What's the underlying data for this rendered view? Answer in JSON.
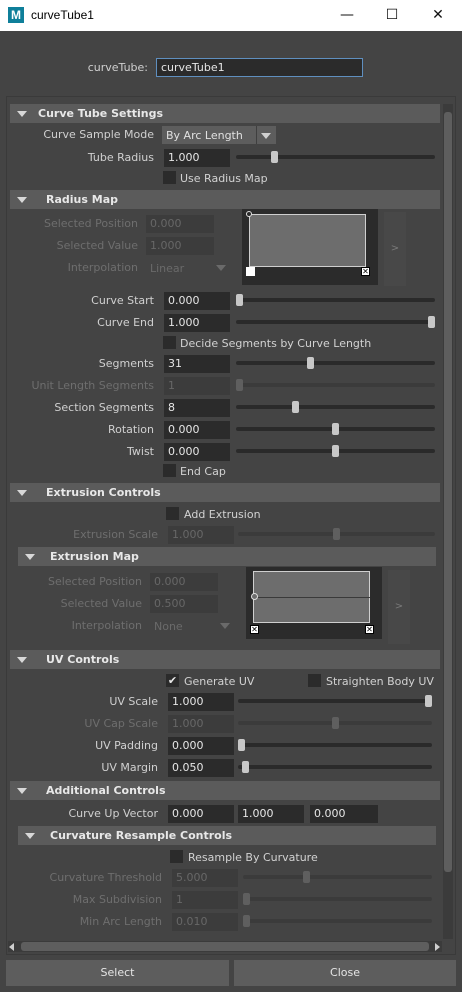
{
  "window": {
    "title": "curveTube1",
    "minimize": "—",
    "maximize": "☐",
    "close": "✕"
  },
  "node": {
    "label": "curveTube:",
    "value": "curveTube1"
  },
  "curve_tube_settings": {
    "header": "Curve Tube Settings",
    "sample_mode_label": "Curve Sample Mode",
    "sample_mode_value": "By Arc Length",
    "tube_radius_label": "Tube Radius",
    "tube_radius_value": "1.000",
    "tube_radius_slider": 0.18,
    "use_radius_map_label": "Use Radius Map"
  },
  "radius_map": {
    "header": "Radius Map",
    "selected_position_label": "Selected Position",
    "selected_position_value": "0.000",
    "selected_value_label": "Selected Value",
    "selected_value_value": "1.000",
    "interpolation_label": "Interpolation",
    "interpolation_value": "Linear",
    "expand_arrow": ">"
  },
  "curve_fields": {
    "curve_start_label": "Curve Start",
    "curve_start_value": "0.000",
    "curve_start_slider": 0.0,
    "curve_end_label": "Curve End",
    "curve_end_value": "1.000",
    "curve_end_slider": 1.0,
    "decide_segments_label": "Decide Segments by Curve Length",
    "segments_label": "Segments",
    "segments_value": "31",
    "segments_slider": 0.37,
    "unit_length_label": "Unit Length Segments",
    "unit_length_value": "1",
    "unit_length_slider": 0.0,
    "section_segments_label": "Section Segments",
    "section_segments_value": "8",
    "section_segments_slider": 0.29,
    "rotation_label": "Rotation",
    "rotation_value": "0.000",
    "rotation_slider": 0.5,
    "twist_label": "Twist",
    "twist_value": "0.000",
    "twist_slider": 0.5,
    "end_cap_label": "End Cap"
  },
  "extrusion_controls": {
    "header": "Extrusion Controls",
    "add_extrusion_label": "Add Extrusion",
    "extrusion_scale_label": "Extrusion Scale",
    "extrusion_scale_value": "1.000",
    "extrusion_scale_slider": 0.5
  },
  "extrusion_map": {
    "header": "Extrusion Map",
    "selected_position_label": "Selected Position",
    "selected_position_value": "0.000",
    "selected_value_label": "Selected Value",
    "selected_value_value": "0.500",
    "interpolation_label": "Interpolation",
    "interpolation_value": "None",
    "expand_arrow": ">"
  },
  "uv_controls": {
    "header": "UV Controls",
    "generate_uv_label": "Generate UV",
    "straighten_label": "Straighten Body UV",
    "uv_scale_label": "UV Scale",
    "uv_scale_value": "1.000",
    "uv_scale_slider": 1.0,
    "uv_cap_scale_label": "UV Cap Scale",
    "uv_cap_scale_value": "1.000",
    "uv_cap_scale_slider": 0.5,
    "uv_padding_label": "UV Padding",
    "uv_padding_value": "0.000",
    "uv_padding_slider": 0.0,
    "uv_margin_label": "UV Margin",
    "uv_margin_value": "0.050",
    "uv_margin_slider": 0.02
  },
  "additional_controls": {
    "header": "Additional Controls",
    "curve_up_label": "Curve Up Vector",
    "curve_up_x": "0.000",
    "curve_up_y": "1.000",
    "curve_up_z": "0.000"
  },
  "curvature_resample": {
    "header": "Curvature Resample Controls",
    "resample_label": "Resample By Curvature",
    "threshold_label": "Curvature Threshold",
    "threshold_value": "5.000",
    "threshold_slider": 0.33,
    "max_subdivision_label": "Max Subdivision",
    "max_subdivision_value": "1",
    "max_subdivision_slider": 0.0,
    "min_arc_label": "Min Arc Length",
    "min_arc_value": "0.010",
    "min_arc_slider": 0.0
  },
  "buttons": {
    "select": "Select",
    "close": "Close"
  },
  "icons": [
    "maya-icon",
    "minimize-icon",
    "maximize-icon",
    "close-icon",
    "collapse-arrow-icon",
    "dropdown-arrow-icon",
    "checkmark-icon",
    "scroll-left-icon",
    "scroll-right-icon"
  ]
}
